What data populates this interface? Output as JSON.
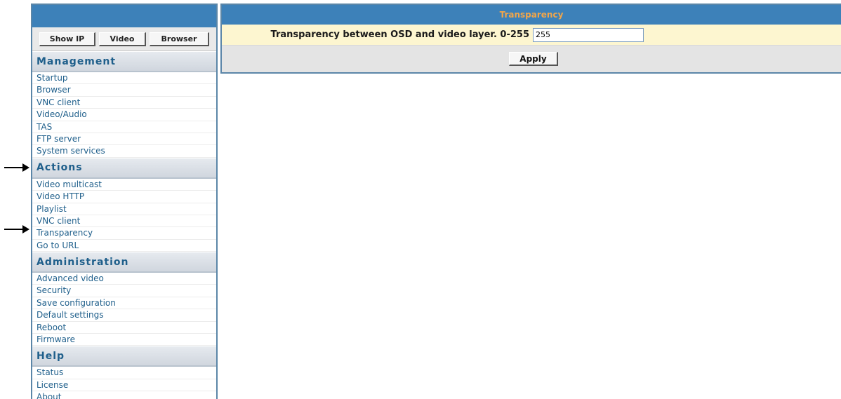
{
  "quick_buttons": [
    "Show IP",
    "Video",
    "Browser"
  ],
  "sections": [
    {
      "title": "Management",
      "items": [
        "Startup",
        "Browser",
        "VNC client",
        "Video/Audio",
        "TAS",
        "FTP server",
        "System services"
      ]
    },
    {
      "title": "Actions",
      "items": [
        "Video multicast",
        "Video HTTP",
        "Playlist",
        "VNC client",
        "Transparency",
        "Go to URL"
      ]
    },
    {
      "title": "Administration",
      "items": [
        "Advanced video",
        "Security",
        "Save configuration",
        "Default settings",
        "Reboot",
        "Firmware"
      ]
    },
    {
      "title": "Help",
      "items": [
        "Status",
        "License",
        "About"
      ]
    }
  ],
  "panel": {
    "title": "Transparency",
    "label": "Transparency between OSD and video layer. 0-255",
    "value": "255",
    "apply_label": "Apply"
  },
  "annotations": [
    "arrow pointing to Actions header",
    "arrow pointing to Transparency item"
  ],
  "colors": {
    "title_bar": "#3d81b9",
    "title_text": "#f2a64a",
    "menu_text": "#1f5f8b",
    "form_row_bg": "#fdf6d0"
  }
}
